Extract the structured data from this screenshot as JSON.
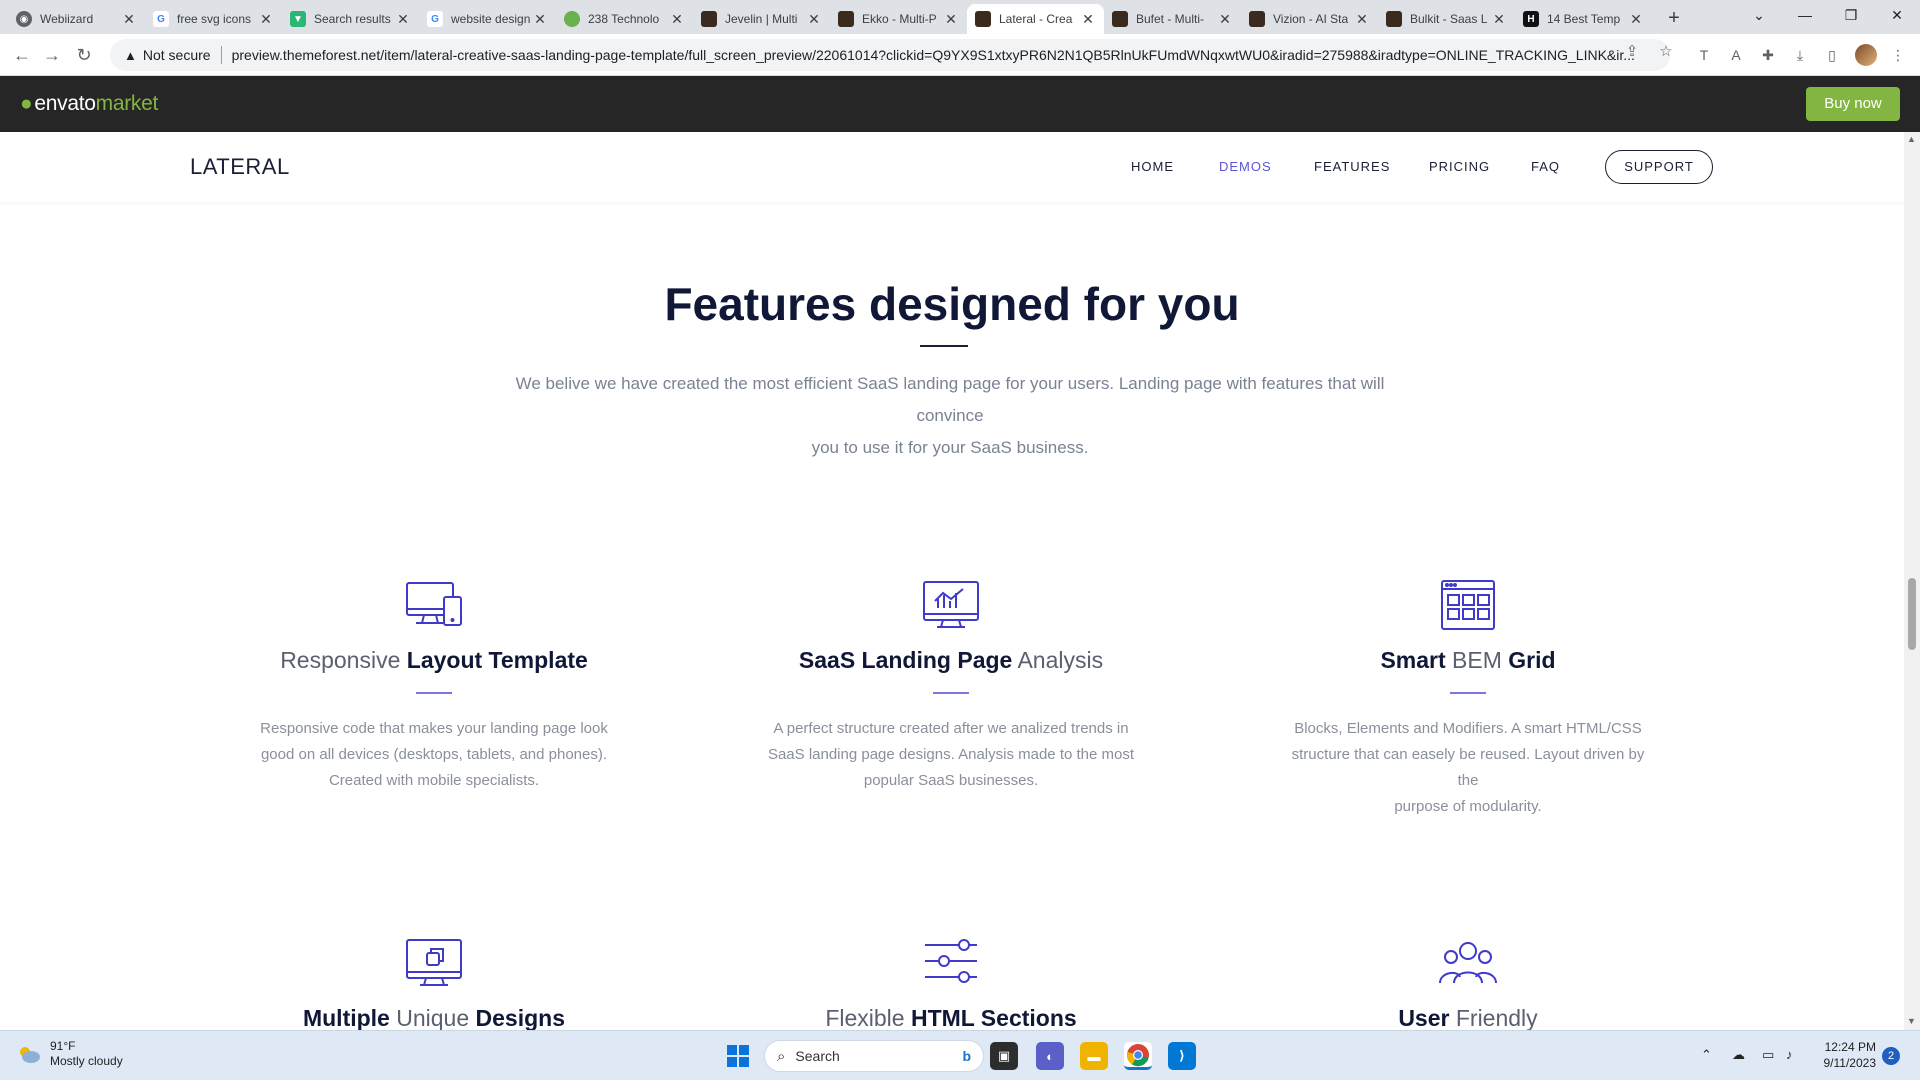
{
  "browser": {
    "tabs": [
      {
        "title": "Webiizard",
        "fav_color": "#5f6368"
      },
      {
        "title": "free svg icons",
        "fav_color": "#4285f4"
      },
      {
        "title": "Search results",
        "fav_color": "#2bb673"
      },
      {
        "title": "website design",
        "fav_color": "#4285f4"
      },
      {
        "title": "238 Technolo",
        "fav_color": "#6ab04c"
      },
      {
        "title": "Jevelin | Multi",
        "fav_color": "#3b2a1e"
      },
      {
        "title": "Ekko - Multi-P",
        "fav_color": "#3b2a1e"
      },
      {
        "title": "Lateral - Crea",
        "fav_color": "#3b2a1e"
      },
      {
        "title": "Bufet - Multi-",
        "fav_color": "#3b2a1e"
      },
      {
        "title": "Vizion - AI Sta",
        "fav_color": "#3b2a1e"
      },
      {
        "title": "Bulkit - Saas L",
        "fav_color": "#3b2a1e"
      },
      {
        "title": "14 Best Temp",
        "fav_color": "#111111"
      }
    ],
    "security_label": "Not secure",
    "url": "preview.themeforest.net/item/lateral-creative-saas-landing-page-template/full_screen_preview/22061014?clickid=Q9YX9S1xtxyPR6N2N1QB5RlnUkFUmdWNqxwtWU0&iradid=275988&iradtype=ONLINE_TRACKING_LINK&ir..."
  },
  "envato": {
    "logo_main": "envato",
    "logo_sub": "market",
    "buy_label": "Buy now",
    "accent": "#82b541"
  },
  "site": {
    "brand": "LATERAL",
    "nav": [
      "HOME",
      "DEMOS",
      "FEATURES",
      "PRICING",
      "FAQ"
    ],
    "support_label": "SUPPORT",
    "accent": "#5a54d6"
  },
  "section": {
    "title": "Features designed for you",
    "intro_line1": "We belive we have created the most efficient SaaS landing page for your users. Landing page with features that will convince",
    "intro_line2": "you to use it for your SaaS business."
  },
  "features": [
    {
      "icon": "devices-icon",
      "t1": "Responsive ",
      "t2": "Layout Template",
      "t3": "",
      "desc": [
        "Responsive code that makes your landing page look",
        "good on all devices (desktops, tablets, and phones).",
        "Created with mobile specialists."
      ]
    },
    {
      "icon": "chart-monitor-icon",
      "t1": "SaaS Landing Page",
      "t2": " Analysis",
      "t3": "",
      "desc": [
        "A perfect structure created after we analized trends in",
        "SaaS landing page designs. Analysis made to the most",
        "popular SaaS businesses."
      ]
    },
    {
      "icon": "grid-layout-icon",
      "t1": "Smart",
      "t2": " BEM ",
      "t3": "Grid",
      "desc": [
        "Blocks, Elements and Modifiers. A smart HTML/CSS",
        "structure that can easely be reused. Layout driven by the",
        "purpose of modularity."
      ]
    },
    {
      "icon": "copies-monitor-icon",
      "t1": "Multiple",
      "t2": " Unique ",
      "t3": "Designs",
      "desc": []
    },
    {
      "icon": "sliders-icon",
      "t1": "Flexible ",
      "t2": "HTML Sections",
      "t3": "",
      "desc": []
    },
    {
      "icon": "users-icon",
      "t1": "User",
      "t2": " Friendly",
      "t3": "",
      "desc": []
    }
  ],
  "taskbar": {
    "temp": "91°F",
    "weather": "Mostly cloudy",
    "search_placeholder": "Search",
    "time": "12:24 PM",
    "date": "9/11/2023",
    "notifications": "2"
  }
}
